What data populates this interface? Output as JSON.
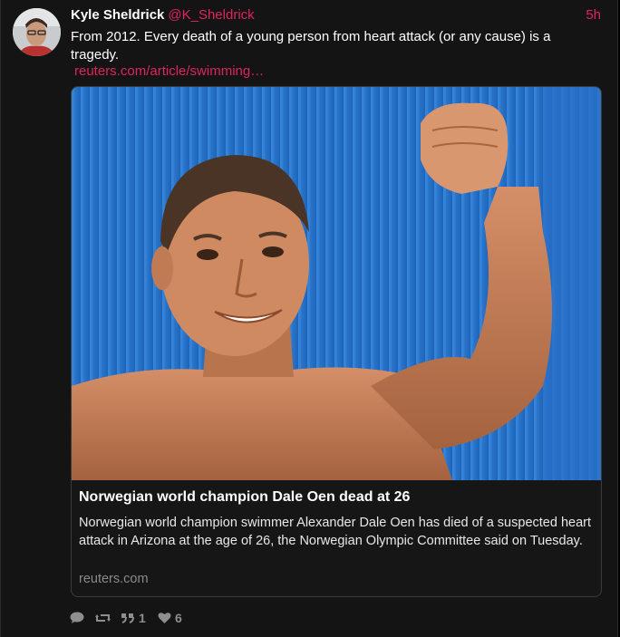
{
  "tweet": {
    "display_name": "Kyle Sheldrick",
    "handle": "@K_Sheldrick",
    "timestamp": "5h",
    "text": "From 2012. Every death of a young person from heart attack (or any cause) is a tragedy.",
    "link_text": "reuters.com/article/swimming…"
  },
  "card": {
    "image_description": "swimmer-raising-fist",
    "title": "Norwegian world champion Dale Oen dead at 26",
    "description": "Norwegian world champion swimmer Alexander Dale Oen has died of a suspected heart attack in Arizona at the age of 26, the Norwegian Olympic Committee said on Tuesday.",
    "domain": "reuters.com"
  },
  "actions": {
    "reply_icon": "speech-bubble-icon",
    "retweet_icon": "retweet-icon",
    "quote_icon": "quote-icon",
    "quote_count": "1",
    "like_icon": "heart-icon",
    "like_count": "6"
  },
  "colors": {
    "background": "#141414",
    "accent": "#e0245e",
    "text": "#ffffff",
    "muted": "#8e8e8e"
  }
}
